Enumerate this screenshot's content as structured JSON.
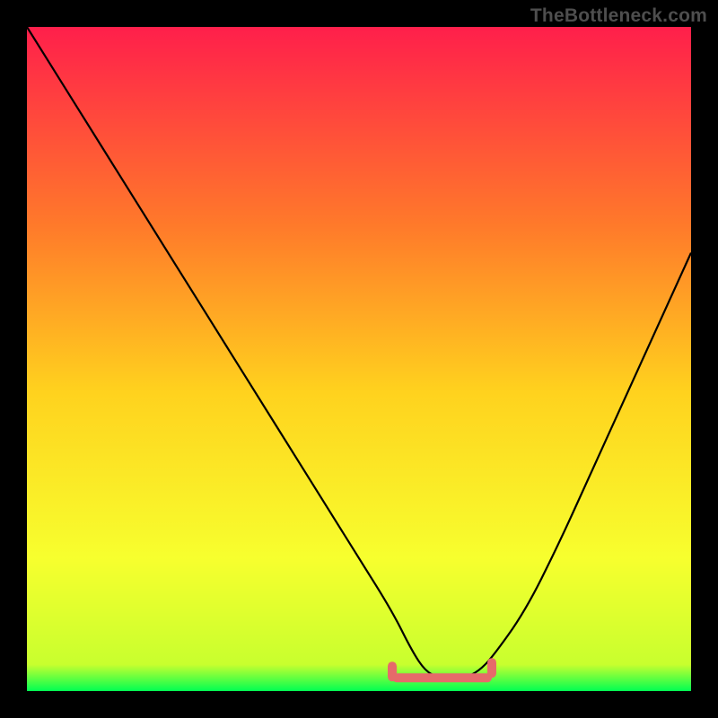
{
  "attribution": "TheBottleneck.com",
  "colors": {
    "gradient_top": "#ff1f4b",
    "gradient_mid1": "#ff7a2a",
    "gradient_mid2": "#ffd21e",
    "gradient_mid3": "#f7ff2e",
    "gradient_bottom": "#00ff52",
    "curve": "#000000",
    "accent": "#e66a6a",
    "frame": "#000000"
  },
  "chart_data": {
    "type": "line",
    "title": "",
    "xlabel": "",
    "ylabel": "",
    "xlim": [
      0,
      100
    ],
    "ylim": [
      0,
      100
    ],
    "grid": false,
    "legend": false,
    "series": [
      {
        "name": "bottleneck-curve",
        "x": [
          0,
          5,
          10,
          15,
          20,
          25,
          30,
          35,
          40,
          45,
          50,
          55,
          58,
          60,
          62,
          64,
          66,
          68,
          70,
          75,
          80,
          85,
          90,
          95,
          100
        ],
        "y": [
          100,
          92,
          84,
          76,
          68,
          60,
          52,
          44,
          36,
          28,
          20,
          12,
          6,
          3,
          2,
          2,
          2,
          3,
          5,
          12,
          22,
          33,
          44,
          55,
          66
        ]
      }
    ],
    "accent_band": {
      "x_start": 55,
      "x_end": 70,
      "y": 2
    },
    "gradient_stops": [
      {
        "offset": 0.0,
        "color": "#ff1f4b"
      },
      {
        "offset": 0.3,
        "color": "#ff7a2a"
      },
      {
        "offset": 0.55,
        "color": "#ffd21e"
      },
      {
        "offset": 0.8,
        "color": "#f7ff2e"
      },
      {
        "offset": 0.96,
        "color": "#c8ff2e"
      },
      {
        "offset": 1.0,
        "color": "#00ff52"
      }
    ]
  }
}
